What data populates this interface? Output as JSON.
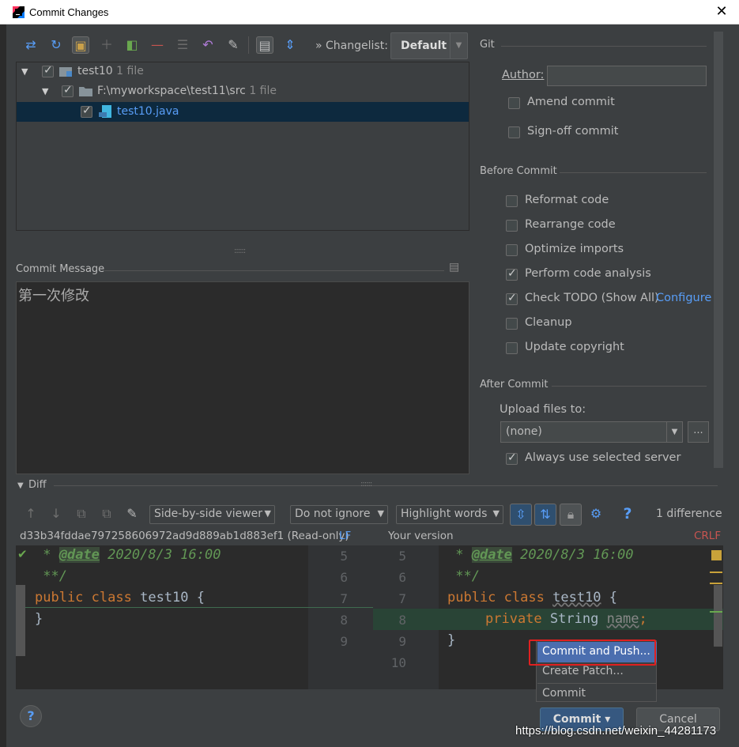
{
  "window": {
    "title": "Commit Changes",
    "close_glyph": "✕"
  },
  "toolbar": {
    "changelist_label": "Changelist:",
    "changelist_value": "Default",
    "expand_glyph": "»"
  },
  "tree": {
    "root": {
      "name": "test10",
      "count": "1 file"
    },
    "folder": {
      "name": "F:\\myworkspace\\test11\\src",
      "count": "1 file"
    },
    "file": {
      "name": "test10.java"
    }
  },
  "commit_message": {
    "label": "Commit Message",
    "text": "第一次修改"
  },
  "git": {
    "section_label": "Git",
    "author_label": "Author:",
    "author_value": "",
    "amend_label": "Amend commit",
    "signoff_label": "Sign-off commit"
  },
  "before_commit": {
    "section_label": "Before Commit",
    "options": [
      {
        "label": "Reformat code",
        "checked": false
      },
      {
        "label": "Rearrange code",
        "checked": false
      },
      {
        "label": "Optimize imports",
        "checked": false
      },
      {
        "label": "Perform code analysis",
        "checked": true
      },
      {
        "label": "Check TODO (Show All)",
        "checked": true
      },
      {
        "label": "Cleanup",
        "checked": false
      },
      {
        "label": "Update copyright",
        "checked": false
      }
    ],
    "configure_link": "Configure"
  },
  "after_commit": {
    "section_label": "After Commit",
    "upload_label": "Upload files to:",
    "upload_value": "(none)",
    "more_glyph": "...",
    "always_label": "Always use selected server"
  },
  "diff": {
    "section_label": "Diff",
    "viewer": "Side-by-side viewer",
    "ignore": "Do not ignore",
    "highlight": "Highlight words",
    "difference_count": "1 difference",
    "left_header": "d33b34fddae797258606972ad9d889ab1d883ef1 (Read-only)",
    "left_eol": "LF",
    "right_header": "Your version",
    "right_eol": "CRLF",
    "left_lines": [
      "5",
      "6",
      "7",
      "8",
      "9"
    ],
    "right_lines": [
      "5",
      "6",
      "7",
      "8",
      "9",
      "10"
    ],
    "code": {
      "date_prefix": " * ",
      "date_tag": "@date",
      "date_value": " 2020/8/3 16:00",
      "comment_end": " **/",
      "kw_public": "public",
      "kw_class": "class",
      "class_name": "test10",
      "open_brace": "{",
      "close_brace": "}",
      "kw_private": "private",
      "type_string": "String",
      "field_name": "name",
      "semicolon": ";"
    }
  },
  "popup_menu": {
    "items": [
      "Commit and Push...",
      "Create Patch...",
      "Commit"
    ]
  },
  "buttons": {
    "help": "?",
    "commit": "Commit",
    "commit_arrow": "▾",
    "cancel": "Cancel"
  },
  "watermark": "https://blog.csdn.net/weixin_44281173",
  "colors": {
    "accent_blue": "#589df6",
    "selection": "#0d293e",
    "added_band": "#294436",
    "highlight_red": "#e02020"
  }
}
